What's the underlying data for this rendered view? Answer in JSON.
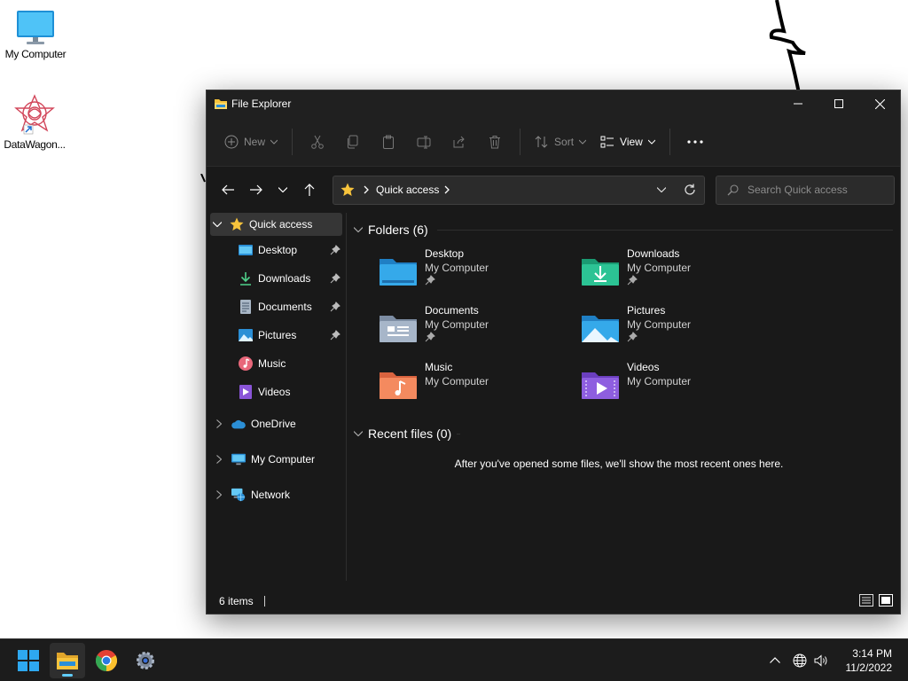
{
  "desktop": {
    "icons": [
      {
        "label": "My Computer",
        "icon": "monitor-icon"
      },
      {
        "label": "DataWagon...",
        "icon": "datawagon-shortcut-icon"
      }
    ]
  },
  "window": {
    "title": "File Explorer",
    "command_bar": {
      "new_label": "New",
      "sort_label": "Sort",
      "view_label": "View"
    },
    "address": {
      "crumb": "Quick access"
    },
    "search": {
      "placeholder": "Search Quick access"
    },
    "sidebar": {
      "quick_access": "Quick access",
      "pinned": [
        {
          "label": "Desktop",
          "pinned": true
        },
        {
          "label": "Downloads",
          "pinned": true
        },
        {
          "label": "Documents",
          "pinned": true
        },
        {
          "label": "Pictures",
          "pinned": true
        },
        {
          "label": "Music",
          "pinned": false
        },
        {
          "label": "Videos",
          "pinned": false
        }
      ],
      "roots": [
        {
          "label": "OneDrive"
        },
        {
          "label": "My Computer"
        },
        {
          "label": "Network"
        }
      ]
    },
    "folders_group": {
      "header": "Folders (6)",
      "items": [
        {
          "name": "Desktop",
          "location": "My Computer",
          "pinned": true
        },
        {
          "name": "Downloads",
          "location": "My Computer",
          "pinned": true
        },
        {
          "name": "Documents",
          "location": "My Computer",
          "pinned": true
        },
        {
          "name": "Pictures",
          "location": "My Computer",
          "pinned": true
        },
        {
          "name": "Music",
          "location": "My Computer",
          "pinned": false
        },
        {
          "name": "Videos",
          "location": "My Computer",
          "pinned": false
        }
      ]
    },
    "recent_group": {
      "header": "Recent files (0)",
      "empty_message": "After you've opened some files, we'll show the most recent ones here."
    },
    "status": {
      "item_count": "6 items"
    }
  },
  "taskbar": {
    "clock_time": "3:14 PM",
    "clock_date": "11/2/2022"
  },
  "colors": {
    "accent": "#60cdff",
    "window_bg": "#191919",
    "chrome_bg": "#202020",
    "folder_yellow": "#f8c43c"
  }
}
